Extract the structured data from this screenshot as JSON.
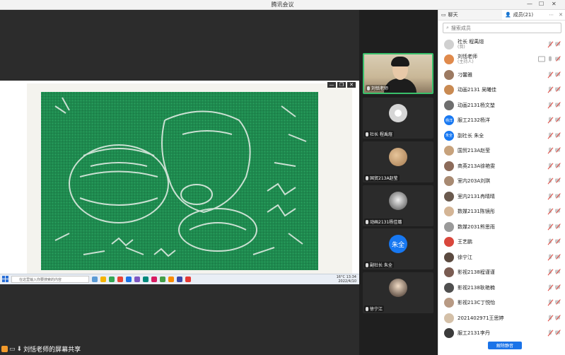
{
  "app": {
    "title": "腾讯会议"
  },
  "share": {
    "status_text": "刘恬老师的屏幕共享",
    "taskbar": {
      "search_placeholder": "在这里输入你要搜索的内容",
      "time": "13:34",
      "date": "2022/4/10",
      "weather": "16°C"
    }
  },
  "tiles": [
    {
      "name": "刘恬老师",
      "avatar": "camera-video"
    },
    {
      "name": "社长 程禹煊",
      "avatar": "default-person-icon"
    },
    {
      "name": "国贸213A赵莹",
      "avatar": "photo"
    },
    {
      "name": "动画2131杨佳璐",
      "avatar": "photo"
    },
    {
      "name": "副社长 朱全",
      "avatar": "text",
      "avatar_text": "朱全"
    },
    {
      "name": "徐宁江",
      "avatar": "photo"
    }
  ],
  "panel": {
    "tab_chat": "聊天",
    "tab_members": "成员(21)",
    "search_placeholder": "搜索成员",
    "unmute_all": "解除静音",
    "members": [
      {
        "name": "社长 程禹煊",
        "role": "(我)",
        "avatar": "#d0d0d0",
        "status": "muted"
      },
      {
        "name": "刘恬老师",
        "role": "(主持人)",
        "avatar": "#e08a4c",
        "status": "host"
      },
      {
        "name": "刁馨雅",
        "role": "",
        "avatar": "#9c7a62",
        "status": "muted"
      },
      {
        "name": "动画2131  吴曦佳",
        "role": "",
        "avatar": "#c98a52",
        "status": "muted"
      },
      {
        "name": "动画2131杨文堃",
        "role": "",
        "avatar": "#6e6e6e",
        "status": "muted"
      },
      {
        "name": "服工2132杨洋",
        "role": "",
        "avatar": "#1778f2",
        "avatar_text": "杨洋",
        "status": "muted"
      },
      {
        "name": "副社长 朱全",
        "role": "",
        "avatar": "#1778f2",
        "avatar_text": "朱全",
        "status": "muted"
      },
      {
        "name": "国贸213A赵莹",
        "role": "",
        "avatar": "#c7a27c",
        "status": "muted"
      },
      {
        "name": "商英213A徐艳雯",
        "role": "",
        "avatar": "#8c6b5a",
        "status": "muted"
      },
      {
        "name": "室内203A刘琪",
        "role": "",
        "avatar": "#a88a72",
        "status": "muted"
      },
      {
        "name": "室内2131冉晴晴",
        "role": "",
        "avatar": "#6a5a4e",
        "status": "muted"
      },
      {
        "name": "数媒2131陈镜彤",
        "role": "",
        "avatar": "#d4b596",
        "status": "muted"
      },
      {
        "name": "数媒2031熊思雨",
        "role": "",
        "avatar": "#9a9a9a",
        "status": "muted"
      },
      {
        "name": "王艺鹏",
        "role": "",
        "avatar": "#d9473c",
        "status": "muted"
      },
      {
        "name": "徐宁江",
        "role": "",
        "avatar": "#5b4a40",
        "status": "muted"
      },
      {
        "name": "影视2138程谨谨",
        "role": "",
        "avatar": "#7a5c52",
        "status": "muted"
      },
      {
        "name": "影视2138耿艳楠",
        "role": "",
        "avatar": "#4f4f4f",
        "status": "muted"
      },
      {
        "name": "影视213C丁悦怡",
        "role": "",
        "avatar": "#b89a84",
        "status": "muted"
      },
      {
        "name": "2021402971王思婷",
        "role": "",
        "avatar": "#d4c0a8",
        "status": "muted"
      },
      {
        "name": "服工2131李丹",
        "role": "",
        "avatar": "#3b3b3b",
        "status": "muted"
      }
    ]
  }
}
